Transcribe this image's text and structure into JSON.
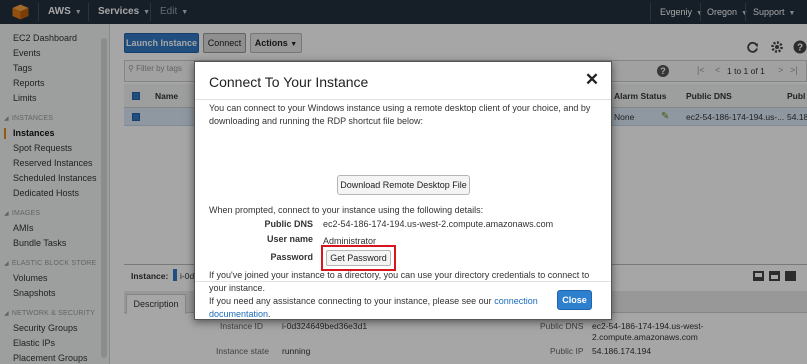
{
  "topbar": {
    "brand": "AWS",
    "services": "Services",
    "edit": "Edit",
    "user": "Evgeniy",
    "region": "Oregon",
    "support": "Support"
  },
  "sidebar": {
    "top_items": [
      {
        "label": "EC2 Dashboard"
      },
      {
        "label": "Events"
      },
      {
        "label": "Tags"
      },
      {
        "label": "Reports"
      },
      {
        "label": "Limits"
      }
    ],
    "sections": [
      {
        "title": "INSTANCES",
        "items": [
          {
            "label": "Instances"
          },
          {
            "label": "Spot Requests"
          },
          {
            "label": "Reserved Instances"
          },
          {
            "label": "Scheduled Instances"
          },
          {
            "label": "Dedicated Hosts"
          }
        ]
      },
      {
        "title": "IMAGES",
        "items": [
          {
            "label": "AMIs"
          },
          {
            "label": "Bundle Tasks"
          }
        ]
      },
      {
        "title": "ELASTIC BLOCK STORE",
        "items": [
          {
            "label": "Volumes"
          },
          {
            "label": "Snapshots"
          }
        ]
      },
      {
        "title": "NETWORK & SECURITY",
        "items": [
          {
            "label": "Security Groups"
          },
          {
            "label": "Elastic IPs"
          },
          {
            "label": "Placement Groups"
          }
        ]
      }
    ]
  },
  "toolbar": {
    "launch_label": "Launch Instance",
    "connect_label": "Connect",
    "actions_label": "Actions"
  },
  "filter": {
    "placeholder": "Filter by tags",
    "pagination": "1 to 1 of 1"
  },
  "table": {
    "headers": {
      "name": "Name",
      "alarm": "Alarm Status",
      "public_dns": "Public DNS",
      "public": "Publ"
    },
    "row": {
      "alarm": "None",
      "public_dns": "ec2-54-186-174-194.us-...",
      "public": "54.18"
    }
  },
  "details": {
    "instance_label": "Instance:",
    "instance_value": "i-0d3",
    "tab_description": "Description",
    "instance_id_label": "Instance ID",
    "instance_id": "i-0d324649bed36e3d1",
    "instance_state_label": "Instance state",
    "instance_state": "running",
    "public_dns_label": "Public DNS",
    "public_dns_line1": "ec2-54-186-174-194.us-west-",
    "public_dns_line2": "2.compute.amazonaws.com",
    "public_ip_label": "Public IP",
    "public_ip": "54.186.174.194"
  },
  "modal": {
    "title": "Connect To Your Instance",
    "intro": "You can connect to your Windows instance using a remote desktop client of your choice, and by downloading and running the RDP shortcut file below:",
    "download_label": "Download Remote Desktop File",
    "prompt": "When prompted, connect to your instance using the following details:",
    "public_dns_label": "Public DNS",
    "public_dns": "ec2-54-186-174-194.us-west-2.compute.amazonaws.com",
    "username_label": "User name",
    "username": "Administrator",
    "password_label": "Password",
    "get_password_label": "Get Password",
    "directory_note": "If you've joined your instance to a directory, you can use your directory credentials to connect to your instance.",
    "help_prefix": "If you need any assistance connecting to your instance, please see our",
    "help_link": "connection documentation",
    "help_suffix": ".",
    "close_label": "Close"
  },
  "colors": {
    "topbar_bg": "#232f3e",
    "primary": "#3279c4",
    "highlight_border": "#d9151d",
    "link": "#1c6ab9"
  }
}
